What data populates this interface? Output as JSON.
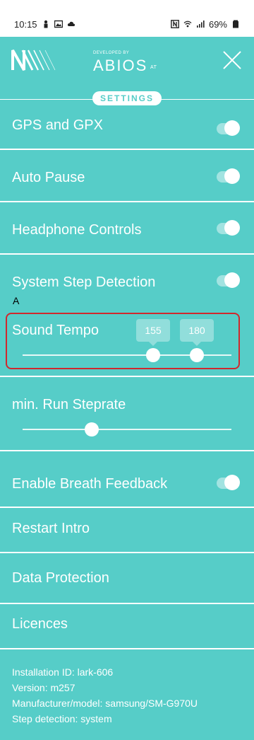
{
  "status": {
    "time": "10:15",
    "battery": "69%"
  },
  "header": {
    "developed_by": "DEVELOPED BY",
    "developer_name": "ABIOS",
    "developer_suffix": "AT",
    "settings_label": "SETTINGS"
  },
  "settings": {
    "gps": {
      "label": "GPS and GPX",
      "enabled": true
    },
    "auto_pause": {
      "label": "Auto Pause",
      "enabled": true
    },
    "headphone": {
      "label": "Headphone Controls",
      "enabled": true
    },
    "step_detection": {
      "label": "System Step Detection",
      "enabled": true
    },
    "sound_tempo": {
      "label": "Sound Tempo",
      "min": 155,
      "max": 180
    },
    "min_run_steprate": {
      "label": "min. Run Steprate"
    },
    "breath_feedback": {
      "label": "Enable Breath Feedback",
      "enabled": true
    },
    "restart_intro": {
      "label": "Restart Intro"
    },
    "data_protection": {
      "label": "Data Protection"
    },
    "licences": {
      "label": "Licences"
    }
  },
  "annotation": {
    "marker": "A"
  },
  "footer": {
    "installation_id": "Installation ID: lark-606",
    "version": "Version: m257",
    "manufacturer": "Manufacturer/model: samsung/SM-G970U",
    "step_detection": "Step detection: system"
  },
  "colors": {
    "background": "#56cdc8",
    "highlight": "#d0282d",
    "text": "#ffffff"
  }
}
